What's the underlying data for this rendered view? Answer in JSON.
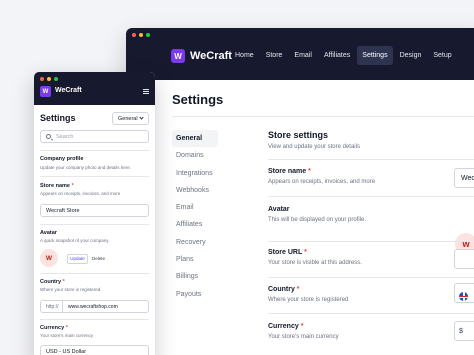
{
  "desktop": {
    "brand": "WeCraft",
    "logo_letter": "W",
    "nav": [
      {
        "label": "Home"
      },
      {
        "label": "Store"
      },
      {
        "label": "Email"
      },
      {
        "label": "Affiliates"
      },
      {
        "label": "Settings",
        "active": true
      },
      {
        "label": "Design"
      },
      {
        "label": "Setup"
      }
    ],
    "page_title": "Settings",
    "subnav": [
      "General",
      "Domains",
      "Integrations",
      "Webhooks",
      "Email",
      "Affiliates",
      "Recovery",
      "Plans",
      "Billings",
      "Payouts"
    ],
    "section": {
      "title": "Store settings",
      "subtitle": "View and update your store details"
    },
    "fields": {
      "store_name": {
        "label": "Store name",
        "required": "*",
        "help": "Appears on receipts, invoices, and more",
        "value": "Wec"
      },
      "avatar": {
        "label": "Avatar",
        "help": "This will be displayed on your profile.",
        "letter": "W"
      },
      "store_url": {
        "label": "Store URL",
        "required": "*",
        "help": "Your store is visible at this address."
      },
      "country": {
        "label": "Country",
        "required": "*",
        "help": "Where your store is registered"
      },
      "currency": {
        "label": "Currency",
        "required": "*",
        "help": "Your store's main currency",
        "symbol": "$"
      }
    }
  },
  "mobile": {
    "brand": "WeCraft",
    "logo_letter": "W",
    "page_title": "Settings",
    "select_value": "General",
    "search_placeholder": "Search",
    "company_profile": {
      "title": "Company profile",
      "subtitle": "Update your company photo and details here."
    },
    "store_name": {
      "label": "Store name",
      "required": "*",
      "help": "Appears on receipts, invoices, and more",
      "value": "Wecraft Store"
    },
    "avatar": {
      "label": "Avatar",
      "help": "A quick snapshot of your company.",
      "letter": "W",
      "update_label": "Update",
      "delete_label": "Delete"
    },
    "country": {
      "label": "Country",
      "required": "*",
      "help": "Where your store is registered.",
      "prefix": "http://",
      "url_value": "www.wecraftshop.com"
    },
    "currency": {
      "label": "Currency",
      "required": "*",
      "help": "Your store's main currency",
      "value": "USD - US Dollar"
    }
  },
  "colors": {
    "accent": "#7c3aed",
    "header_bg": "#171a2e",
    "avatar_bg": "#fde2e0"
  }
}
